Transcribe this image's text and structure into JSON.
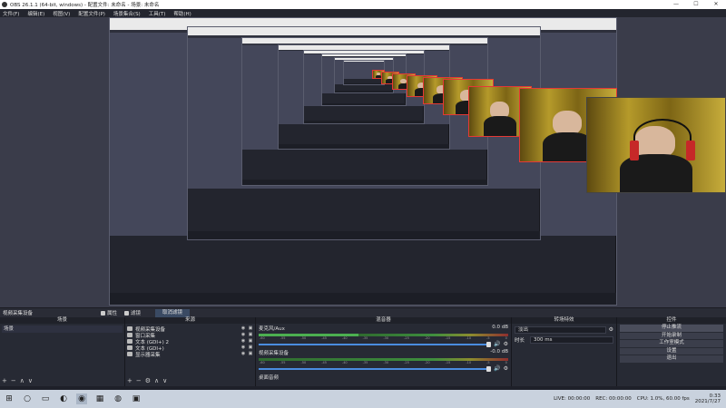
{
  "window": {
    "title": "OBS 26.1.1 (64-bit, windows) - 配置文件: 未命名 - 场景: 未命名",
    "minimize_glyph": "—",
    "maximize_glyph": "☐",
    "close_glyph": "✕"
  },
  "menu": [
    "文件(F)",
    "编辑(E)",
    "视图(V)",
    "配置文件(P)",
    "场景集合(S)",
    "工具(T)",
    "帮助(H)"
  ],
  "scene_toolbar": {
    "current_source": "视频采集设备",
    "properties": "属性",
    "filters_icon_label": "滤镜",
    "filters_tab": "取消滤镜"
  },
  "docks": {
    "scenes": {
      "title": "场景",
      "items": [
        "场景"
      ]
    },
    "sources": {
      "title": "来源",
      "items": [
        "视频采集设备",
        "窗口采集",
        "文本 (GDI+) 2",
        "文本 (GDI+)",
        "显示器采集"
      ]
    },
    "mixer": {
      "title": "混音器",
      "tracks": [
        {
          "name": "麦克风/Aux",
          "db": "0.0 dB"
        },
        {
          "name": "视频采集设备",
          "db": "-0.0 dB"
        },
        {
          "name": "桌面音频",
          "db": ""
        }
      ],
      "ticks": [
        "-60",
        "-55",
        "-50",
        "-45",
        "-40",
        "-35",
        "-30",
        "-25",
        "-20",
        "-15",
        "-10",
        "-5",
        "0"
      ]
    },
    "transitions": {
      "title": "转场特效",
      "type": "淡出",
      "duration_label": "时长",
      "duration_value": "300 ms"
    },
    "controls": {
      "title": "控件",
      "buttons": [
        "停止推流",
        "开始录制",
        "工作室模式",
        "设置",
        "退出"
      ]
    },
    "footer_icons": {
      "add": "+",
      "remove": "−",
      "up": "∧",
      "down": "∨",
      "settings": "⚙"
    }
  },
  "status": {
    "live": "LIVE: 00:00:00",
    "rec": "REC: 00:00:00",
    "cpu": "CPU: 1.0%, 60.00 fps"
  },
  "taskbar": {
    "time": "0:33",
    "date": "2021/7/27",
    "start_icon": "windows-start-icon"
  },
  "colors": {
    "accent": "#4a8de0",
    "panel": "#272a34",
    "webcam_border": "#e53935"
  }
}
